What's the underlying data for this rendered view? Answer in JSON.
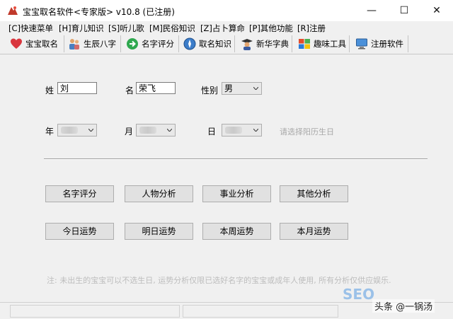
{
  "window": {
    "title": "宝宝取名软件<专家版> v10.8 (已注册)",
    "controls": {
      "minimize": "—",
      "maximize": "☐",
      "close": "✕"
    }
  },
  "menu": [
    {
      "label": "[C]快速菜单"
    },
    {
      "label": "[H]育儿知识"
    },
    {
      "label": "[S]听儿歌"
    },
    {
      "label": "[M]民俗知识"
    },
    {
      "label": "[Z]占卜算命"
    },
    {
      "label": "[P]其他功能"
    },
    {
      "label": "[R]注册"
    }
  ],
  "toolbar": [
    {
      "label": "宝宝取名",
      "icon": "heart-icon"
    },
    {
      "label": "生辰八字",
      "icon": "people-icon"
    },
    {
      "label": "名字评分",
      "icon": "arrow-right-icon"
    },
    {
      "label": "取名知识",
      "icon": "compass-icon"
    },
    {
      "label": "新华字典",
      "icon": "graduate-icon"
    },
    {
      "label": "趣味工具",
      "icon": "windows-icon"
    },
    {
      "label": "注册软件",
      "icon": "monitor-icon"
    }
  ],
  "form": {
    "surname_label": "姓",
    "surname_value": "刘",
    "name_label": "名",
    "name_value": "荣飞",
    "gender_label": "性别",
    "gender_value": "男",
    "year_label": "年",
    "month_label": "月",
    "day_label": "日",
    "date_hint": "请选择阳历生日"
  },
  "buttons_row1": [
    "名字评分",
    "人物分析",
    "事业分析",
    "其他分析"
  ],
  "buttons_row2": [
    "今日运势",
    "明日运势",
    "本周运势",
    "本月运势"
  ],
  "note": "注: 未出生的宝宝可以不选生日, 运势分析仅限已选好名字的宝宝或成年人使用, 所有分析仅供应娱乐.",
  "watermark": {
    "seo": "SEO",
    "brand": "头条 @一锅汤"
  },
  "colors": {
    "accent_red": "#c0392b",
    "watermark_blue": "#6aa8e0"
  }
}
